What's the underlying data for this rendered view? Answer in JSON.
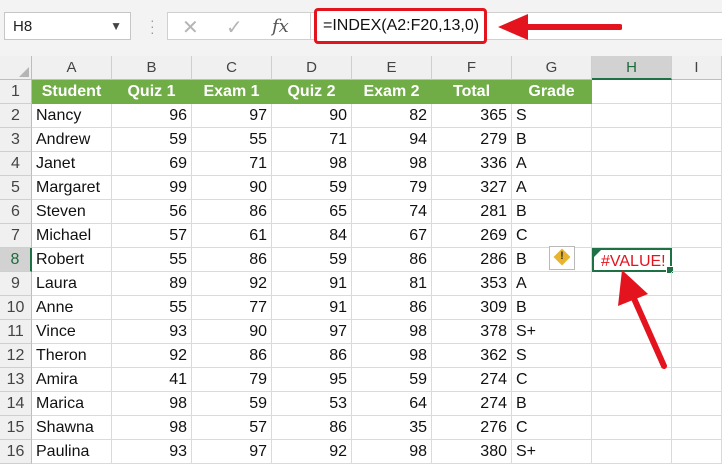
{
  "name_box": {
    "value": "H8",
    "dropdown_icon": "chevron-down-icon"
  },
  "formula_bar": {
    "cancel_icon": "close-icon",
    "enter_icon": "check-icon",
    "fx_label": "fx",
    "formula": "=INDEX(A2:F20,13,0)"
  },
  "annotation_color": "#e3141e",
  "header_fill_color": "#70ad47",
  "column_letters": [
    "A",
    "B",
    "C",
    "D",
    "E",
    "F",
    "G",
    "H",
    "I"
  ],
  "selected_column": "H",
  "selected_row": 8,
  "row_numbers": [
    "1",
    "2",
    "3",
    "4",
    "5",
    "6",
    "7",
    "8",
    "9",
    "10",
    "11",
    "12",
    "13",
    "14",
    "15",
    "16"
  ],
  "table": {
    "headers": [
      "Student",
      "Quiz 1",
      "Exam 1",
      "Quiz 2",
      "Exam 2",
      "Total",
      "Grade"
    ],
    "rows": [
      [
        "Nancy",
        "96",
        "97",
        "90",
        "82",
        "365",
        "S"
      ],
      [
        "Andrew",
        "59",
        "55",
        "71",
        "94",
        "279",
        "B"
      ],
      [
        "Janet",
        "69",
        "71",
        "98",
        "98",
        "336",
        "A"
      ],
      [
        "Margaret",
        "99",
        "90",
        "59",
        "79",
        "327",
        "A"
      ],
      [
        "Steven",
        "56",
        "86",
        "65",
        "74",
        "281",
        "B"
      ],
      [
        "Michael",
        "57",
        "61",
        "84",
        "67",
        "269",
        "C"
      ],
      [
        "Robert",
        "55",
        "86",
        "59",
        "86",
        "286",
        "B"
      ],
      [
        "Laura",
        "89",
        "92",
        "91",
        "81",
        "353",
        "A"
      ],
      [
        "Anne",
        "55",
        "77",
        "91",
        "86",
        "309",
        "B"
      ],
      [
        "Vince",
        "93",
        "90",
        "97",
        "98",
        "378",
        "S+"
      ],
      [
        "Theron",
        "92",
        "86",
        "86",
        "98",
        "362",
        "S"
      ],
      [
        "Amira",
        "41",
        "79",
        "95",
        "59",
        "274",
        "C"
      ],
      [
        "Marica",
        "98",
        "59",
        "53",
        "64",
        "274",
        "B"
      ],
      [
        "Shawna",
        "98",
        "57",
        "86",
        "35",
        "276",
        "C"
      ],
      [
        "Paulina",
        "93",
        "97",
        "92",
        "98",
        "380",
        "S+"
      ]
    ]
  },
  "active_cell": {
    "ref": "H8",
    "value": "#VALUE!"
  },
  "error_indicator_icon": "warning-icon"
}
